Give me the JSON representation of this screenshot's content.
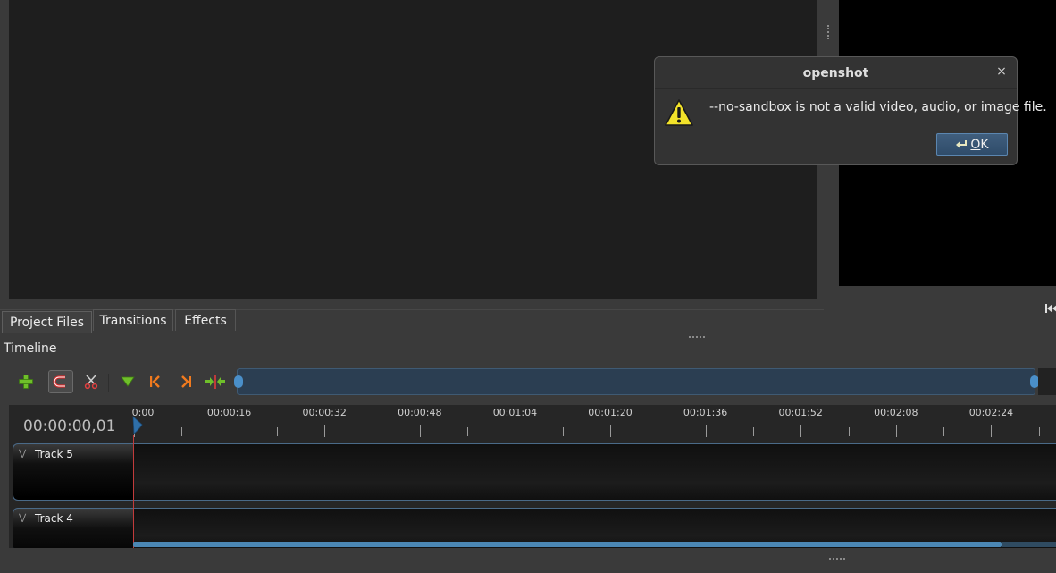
{
  "tabs": [
    "Project Files",
    "Transitions",
    "Effects"
  ],
  "timeline": {
    "title": "Timeline",
    "timecode": "00:00:00,01",
    "ruler_labels": [
      "0:00",
      "00:00:16",
      "00:00:32",
      "00:00:48",
      "00:01:04",
      "00:01:20",
      "00:01:36",
      "00:01:52",
      "00:02:08",
      "00:02:24"
    ],
    "tracks": [
      "Track 5",
      "Track 4"
    ]
  },
  "toolbar": {
    "icons": [
      "add-track-icon",
      "snap-magnet-icon",
      "razor-icon",
      "add-marker-icon",
      "previous-marker-icon",
      "next-marker-icon",
      "center-playhead-icon"
    ]
  },
  "dialog": {
    "title": "openshot",
    "close_glyph": "×",
    "message": "--no-sandbox is not a valid video, audio, or image file.",
    "ok_label_underlined": "O",
    "ok_label_rest": "K"
  },
  "colors": {
    "accent": "#4a8fc9",
    "playhead": "#c23b3b",
    "track_border": "#4a6a88"
  }
}
